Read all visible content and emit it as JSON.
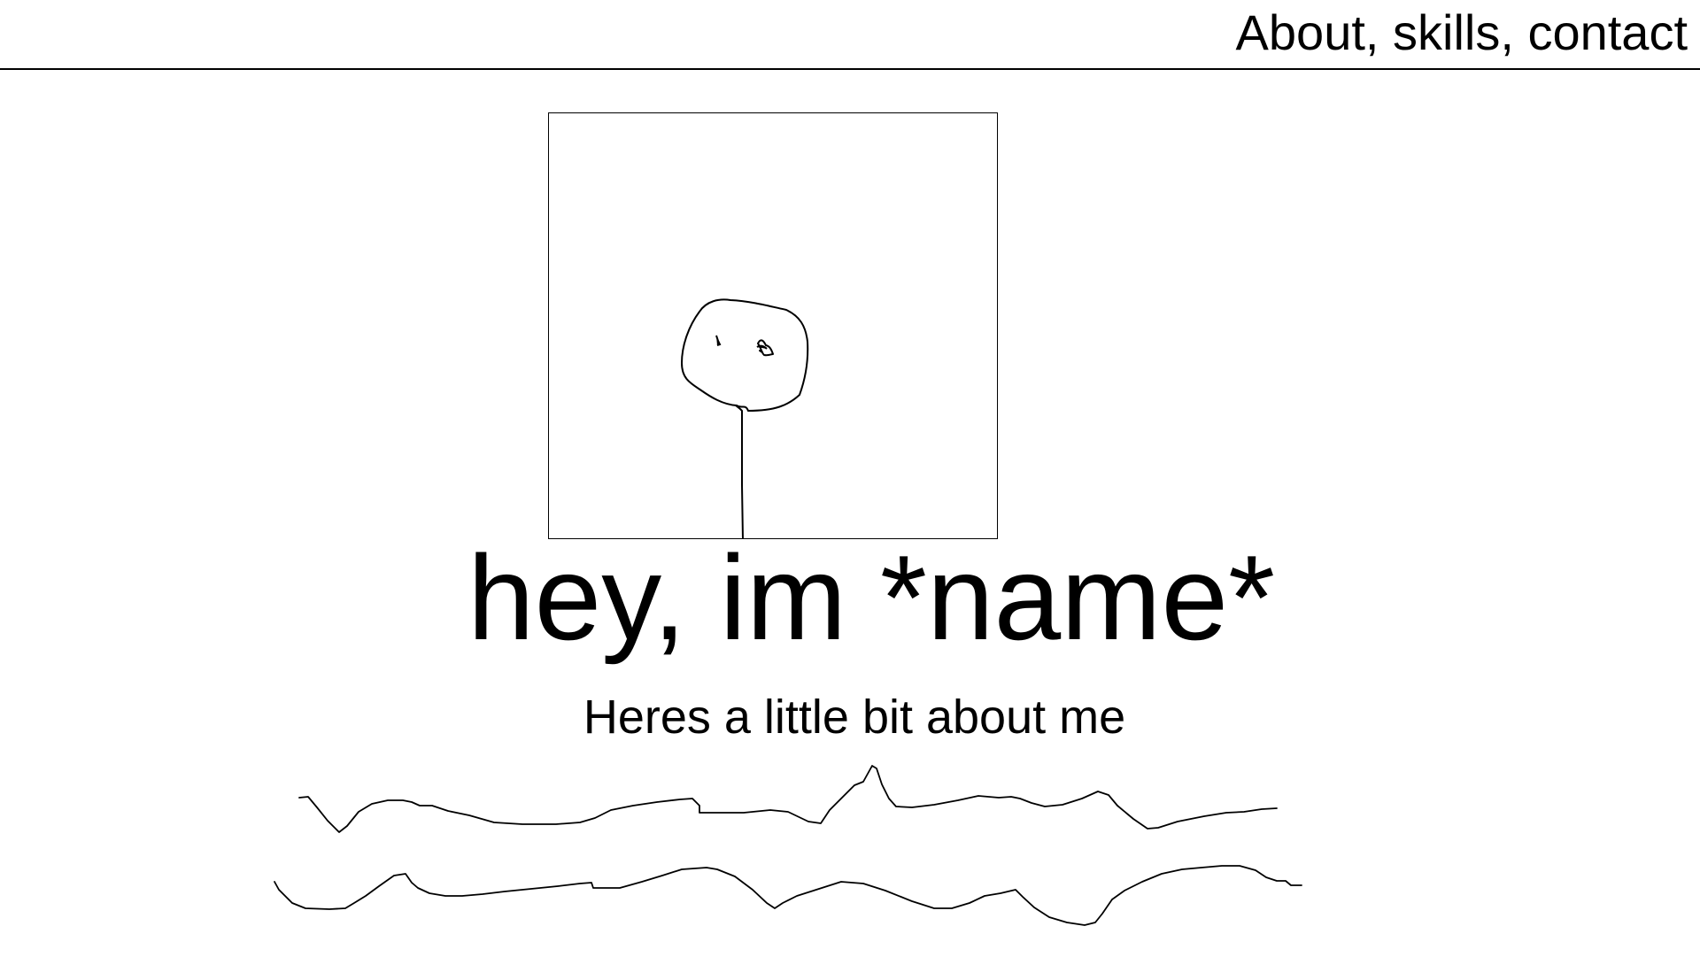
{
  "header": {
    "nav_label": "About, skills, contact"
  },
  "hero": {
    "photo_icon": "stick-figure-drawing",
    "title": "hey, im *name*",
    "subtitle": "Heres a little bit about me"
  },
  "about": {
    "placeholder_icon": "scribble-text-lines"
  },
  "colors": {
    "background": "#ffffff",
    "ink": "#000000"
  }
}
